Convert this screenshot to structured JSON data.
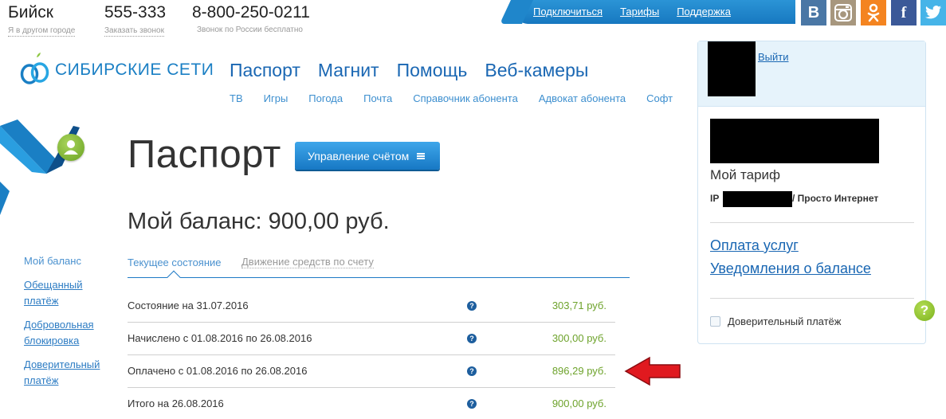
{
  "contacts": {
    "city": "Бийск",
    "city_note": "Я в другом городе",
    "phone_local": "555-333",
    "callback": "Заказать звонок",
    "phone_free": "8-800-250-0211",
    "phone_free_note": "Звонок по России бесплатно"
  },
  "topnav": {
    "connect": "Подключиться",
    "tariffs": "Тарифы",
    "support": "Поддержка"
  },
  "social": [
    {
      "name": "vk",
      "label": "В",
      "color": "#4a77a5"
    },
    {
      "name": "instagram",
      "label": "",
      "color": "#a7977e"
    },
    {
      "name": "odnoklassniki",
      "label": "",
      "color": "#f48420"
    },
    {
      "name": "facebook",
      "label": "f",
      "color": "#3b5998"
    },
    {
      "name": "twitter",
      "label": "",
      "color": "#46b4e8"
    }
  ],
  "logo": {
    "text": "СИБИРСКИЕ СЕТИ"
  },
  "mainnav": [
    "Паспорт",
    "Магнит",
    "Помощь",
    "Веб-камеры"
  ],
  "subnav": [
    "ТВ",
    "Игры",
    "Погода",
    "Почта",
    "Справочник абонента",
    "Адвокат абонента",
    "Софт"
  ],
  "page": {
    "title": "Паспорт",
    "manage_button": "Управление счётом",
    "balance": "Мой баланс: 900,00 руб."
  },
  "sidemenu": [
    {
      "label": "Мой баланс",
      "active": true
    },
    {
      "label": "Обещанный платёж",
      "active": false
    },
    {
      "label": "Добровольная блокировка",
      "active": false
    },
    {
      "label": "Доверительный платёж",
      "active": false
    }
  ],
  "tabs": {
    "current": "Текущее состояние",
    "moves": "Движение средств по счету"
  },
  "rows": [
    {
      "label": "Состояние на 31.07.2016",
      "help": "?",
      "value": "303,71 руб."
    },
    {
      "label": "Начислено с 01.08.2016 по 26.08.2016",
      "help": "?",
      "value": "300,00 руб."
    },
    {
      "label": "Оплачено с 01.08.2016 по 26.08.2016",
      "help": "?",
      "value": "896,29 руб."
    },
    {
      "label": "Итого на 26.08.2016",
      "help": "?",
      "value": "900,00 руб."
    }
  ],
  "panel": {
    "logout": "Выйти",
    "tariff_title": "Мой тариф",
    "tariff_ip": "IP",
    "tariff_name": "/ Просто Интернет",
    "pay_link": "Оплата услуг",
    "notify_link": "Уведомления о балансе",
    "trust_label": "Доверительный платёж"
  },
  "help_bubble": "?",
  "colors": {
    "brand_blue": "#1a67b3",
    "accent_blue": "#1778c4",
    "value_green": "#6ea32c",
    "arrow_red": "#e0191f"
  }
}
